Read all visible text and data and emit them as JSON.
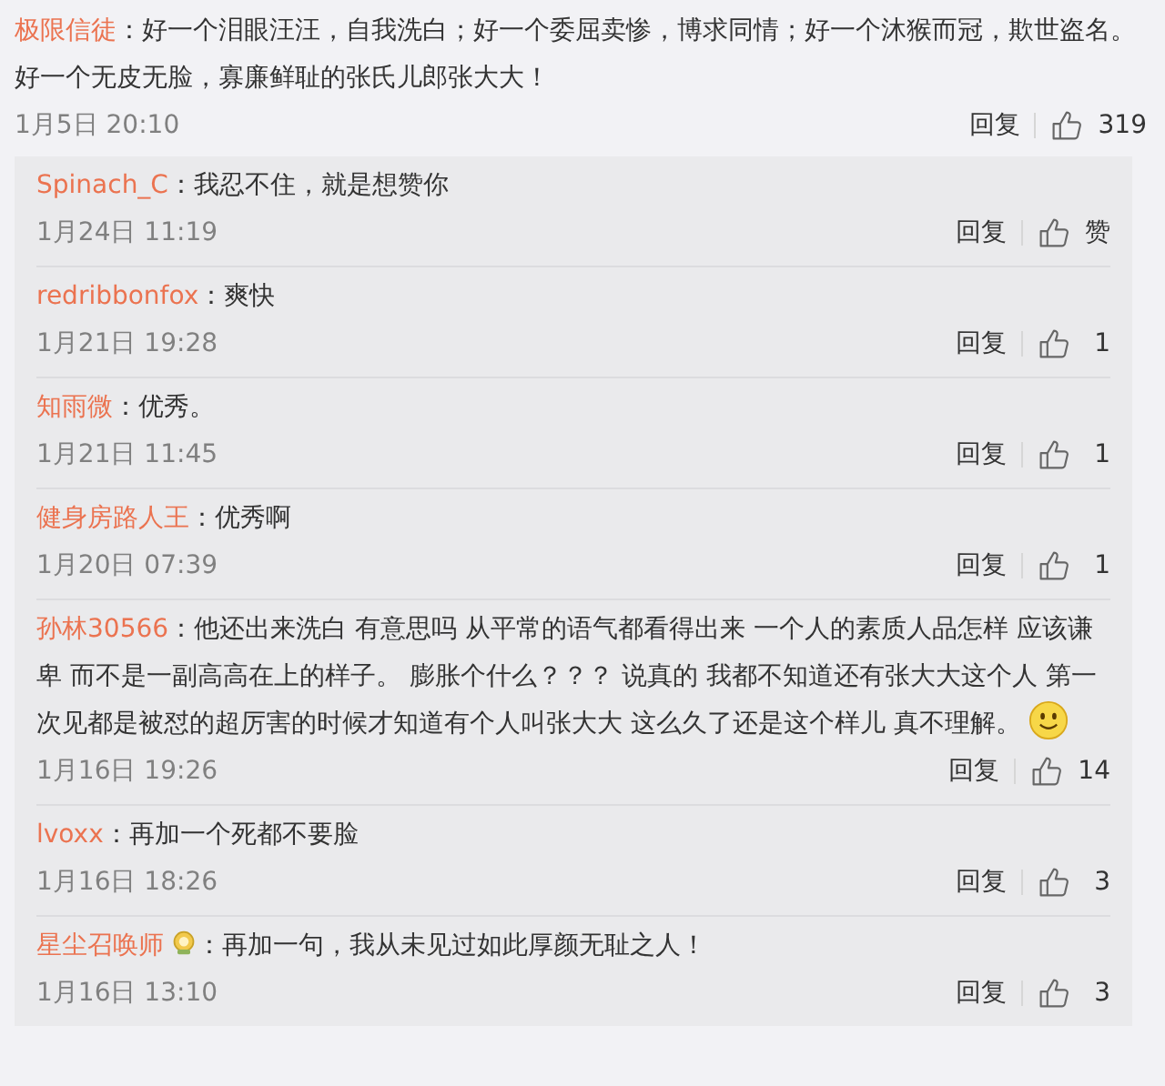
{
  "comment": {
    "user": "极限信徒",
    "text": "：好一个泪眼汪汪，自我洗白；好一个委屈卖惨，博求同情；好一个沐猴而冠，欺世盗名。好一个无皮无脸，寡廉鲜耻的张氏儿郎张大大！",
    "time": "1月5日 20:10",
    "reply": "回复",
    "likes": "319"
  },
  "replies": [
    {
      "user": "Spinach_C",
      "badge": false,
      "text": "：我忍不住，就是想赞你",
      "emoji": false,
      "time": "1月24日 11:19",
      "reply": "回复",
      "likes": "赞"
    },
    {
      "user": "redribbonfox",
      "badge": false,
      "text": "：爽快",
      "emoji": false,
      "time": "1月21日 19:28",
      "reply": "回复",
      "likes": "1"
    },
    {
      "user": "知雨微",
      "badge": false,
      "text": "：优秀。",
      "emoji": false,
      "time": "1月21日 11:45",
      "reply": "回复",
      "likes": "1"
    },
    {
      "user": "健身房路人王",
      "badge": false,
      "text": "：优秀啊",
      "emoji": false,
      "time": "1月20日 07:39",
      "reply": "回复",
      "likes": "1"
    },
    {
      "user": "孙林30566",
      "badge": false,
      "text": "：他还出来洗白 有意思吗  从平常的语气都看得出来 一个人的素质人品怎样 应该谦卑 而不是一副高高在上的样子。 膨胀个什么？？？  说真的 我都不知道还有张大大这个人 第一次见都是被怼的超厉害的时候才知道有个人叫张大大 这么久了还是这个样儿 真不理解。",
      "emoji": true,
      "time": "1月16日 19:26",
      "reply": "回复",
      "likes": "14"
    },
    {
      "user": "lvoxx",
      "badge": false,
      "text": "：再加一个死都不要脸",
      "emoji": false,
      "time": "1月16日 18:26",
      "reply": "回复",
      "likes": "3"
    },
    {
      "user": "星尘召唤师",
      "badge": true,
      "text": "：再加一句，我从未见过如此厚颜无耻之人！",
      "emoji": false,
      "time": "1月16日 13:10",
      "reply": "回复",
      "likes": "3"
    }
  ]
}
